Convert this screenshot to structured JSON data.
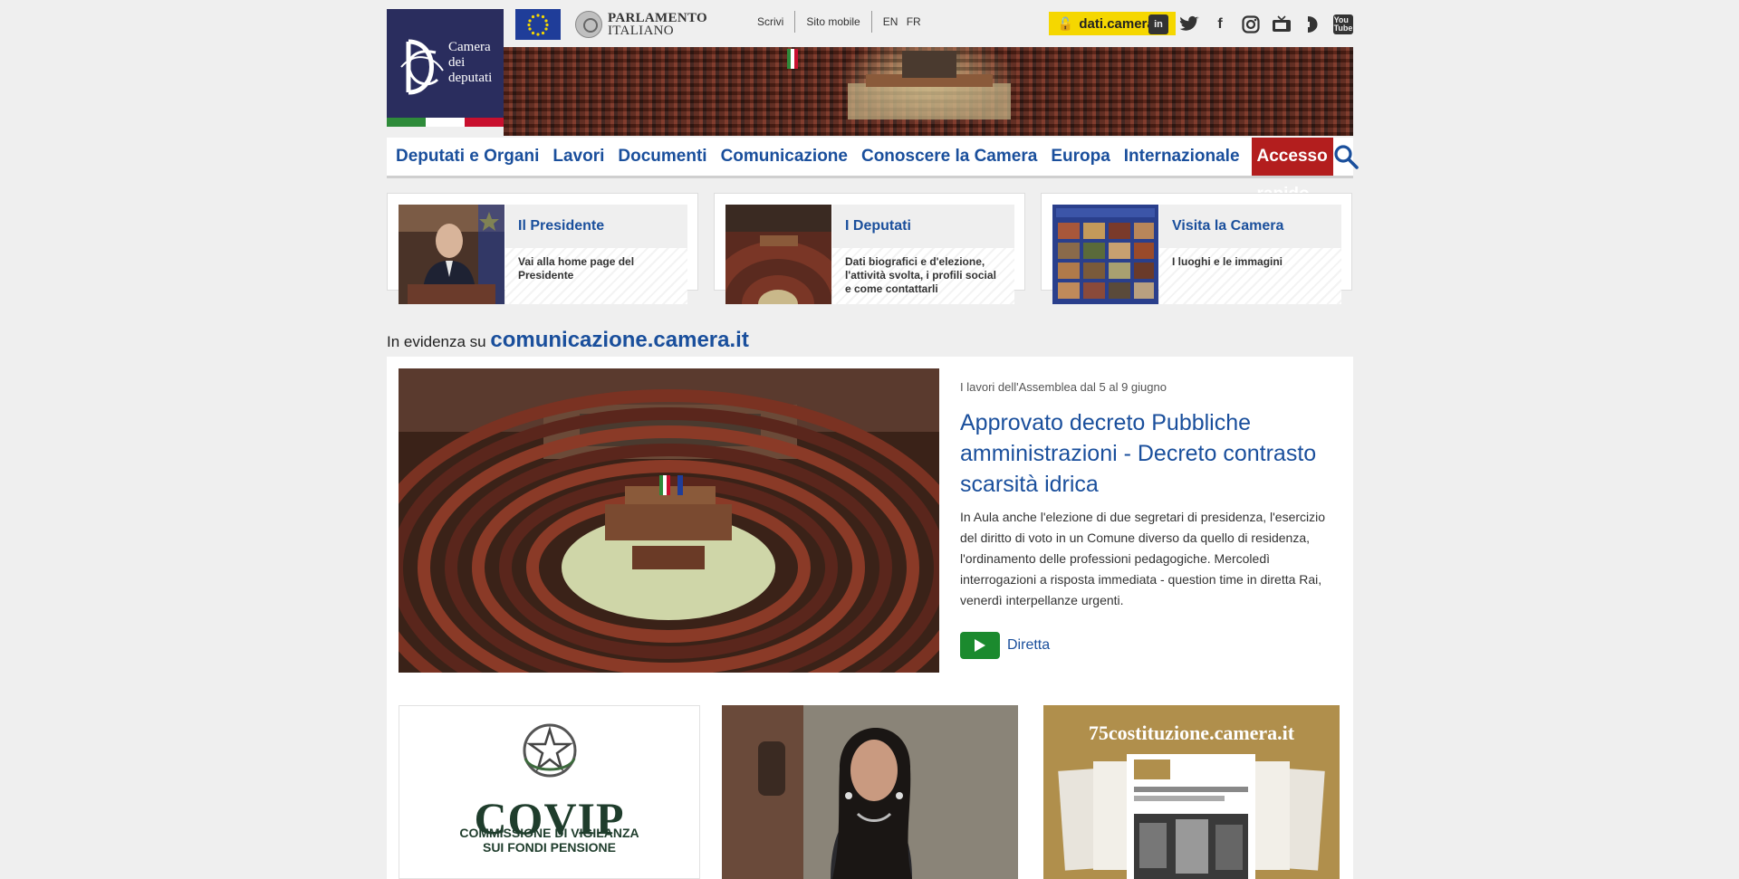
{
  "logo": {
    "line1": "Camera",
    "line2": "dei",
    "line3": "deputati",
    "flag_colors": [
      "#2e8b3a",
      "#ffffff",
      "#c8102e"
    ]
  },
  "topbar": {
    "parliament_line1": "PARLAMENTO",
    "parliament_line2": "ITALIANO",
    "links": {
      "write": "Scrivi",
      "mobile": "Sito mobile",
      "lang": "EN FR"
    },
    "dati_label": "dati.camera.it",
    "social": [
      "linkedin-icon",
      "twitter-icon",
      "facebook-icon",
      "instagram-icon",
      "tv-icon",
      "webtv-icon",
      "youtube-icon"
    ]
  },
  "nav": {
    "items": [
      "Deputati e Organi",
      "Lavori",
      "Documenti",
      "Comunicazione",
      "Conoscere la Camera",
      "Europa",
      "Internazionale"
    ],
    "quick_access": "Accesso rapido"
  },
  "cards": [
    {
      "title": "Il Presidente",
      "desc": "Vai alla home page del Presidente"
    },
    {
      "title": "I Deputati",
      "desc": "Dati biografici e d'elezione, l'attività svolta, i profili social e come contattarli"
    },
    {
      "title": "Visita la Camera",
      "desc": "I luoghi e le immagini"
    }
  ],
  "evidenza": {
    "prefix": "In evidenza su",
    "site": "comunicazione.camera.it"
  },
  "feature": {
    "kicker": "I lavori dell'Assemblea dal 5 al 9 giugno",
    "headline": "Approvato decreto Pubbliche amministrazioni - Decreto contrasto scarsità idrica",
    "summary": "In Aula anche l'elezione di due segretari di presidenza, l'esercizio del diritto di voto in un Comune diverso da quello di residenza, l'ordinamento delle professioni pedagogiche. Mercoledì interrogazioni a risposta immediata - question time in diretta Rai, venerdì interpellanze urgenti.",
    "live_label": "Diretta"
  },
  "tiles": {
    "covip_name": "COVIP",
    "covip_line1": "COMMISSIONE DI VIGILANZA",
    "covip_line2": "SUI FONDI PENSIONE",
    "anniversary_title": "75costituzione.camera.it"
  },
  "colors": {
    "brand_blue": "#1a4f9c",
    "logo_navy": "#2a2d5e",
    "accent_red": "#b31e1e",
    "dati_yellow": "#f5d700",
    "live_green": "#1b8a2e"
  }
}
